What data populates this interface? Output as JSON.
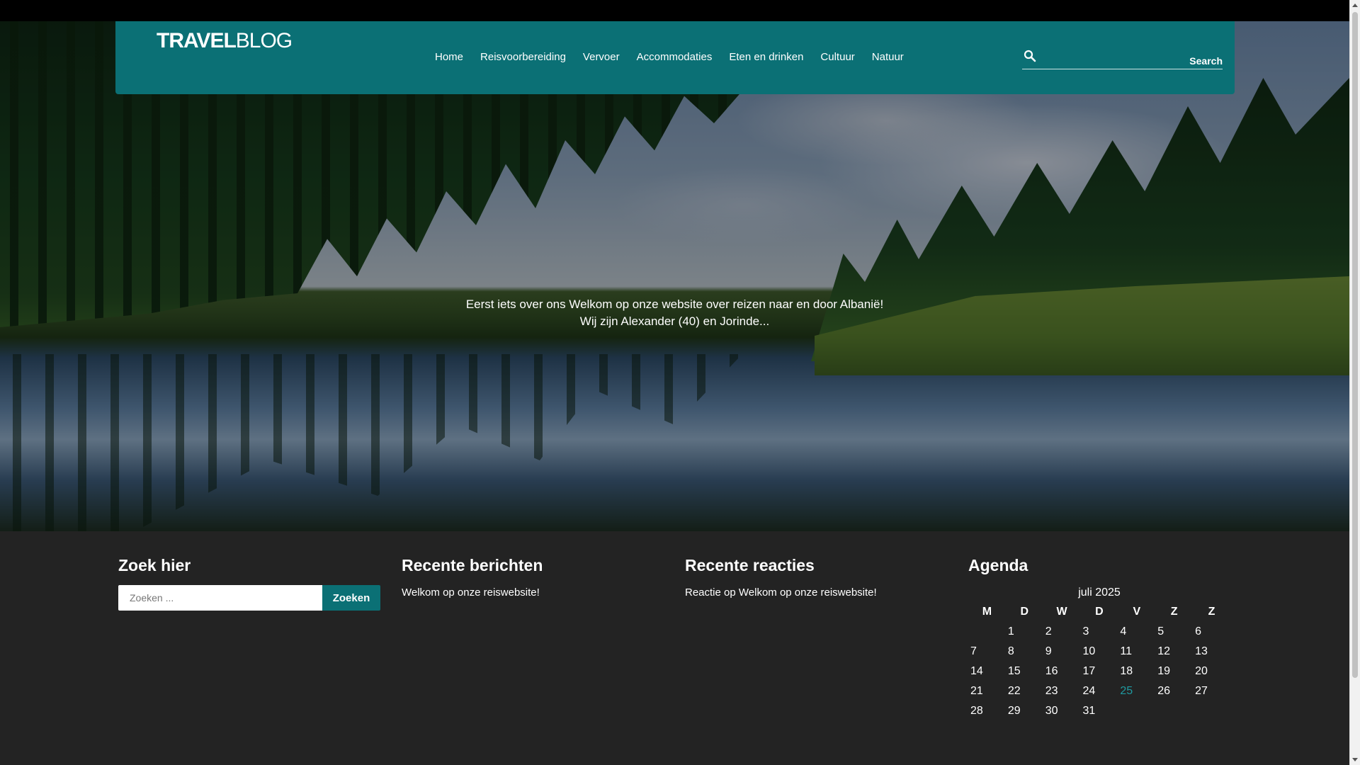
{
  "logo": {
    "bold": "TRAVEL",
    "light": "BLOG"
  },
  "nav": [
    {
      "label": "Home"
    },
    {
      "label": "Reisvoorbereiding"
    },
    {
      "label": "Vervoer"
    },
    {
      "label": "Accommodaties"
    },
    {
      "label": "Eten en drinken"
    },
    {
      "label": "Cultuur"
    },
    {
      "label": "Natuur"
    }
  ],
  "header_search": {
    "label": "Search",
    "icon": "search-icon"
  },
  "hero": {
    "line1": "Eerst iets over ons Welkom op onze website over reizen naar en door Albanië!",
    "line2": "Wij zijn Alexander (40) en Jorinde..."
  },
  "widgets": {
    "search": {
      "title": "Zoek hier",
      "placeholder": "Zoeken ...",
      "button": "Zoeken"
    },
    "recent_posts": {
      "title": "Recente berichten",
      "items": [
        "Welkom op onze reiswebsite!"
      ]
    },
    "recent_comments": {
      "title": "Recente reacties",
      "items": [
        "Reactie op Welkom op onze reiswebsite!"
      ]
    },
    "calendar": {
      "title": "Agenda",
      "caption": "juli 2025",
      "weekdays": [
        "M",
        "D",
        "W",
        "D",
        "V",
        "Z",
        "Z"
      ],
      "weeks": [
        [
          "",
          "1",
          "2",
          "3",
          "4",
          "5",
          "6"
        ],
        [
          "7",
          "8",
          "9",
          "10",
          "11",
          "12",
          "13"
        ],
        [
          "14",
          "15",
          "16",
          "17",
          "18",
          "19",
          "20"
        ],
        [
          "21",
          "22",
          "23",
          "24",
          "25",
          "26",
          "27"
        ],
        [
          "28",
          "29",
          "30",
          "31",
          "",
          "",
          ""
        ]
      ],
      "today": "25",
      "today_color": "#1f9aa0"
    }
  },
  "colors": {
    "accent": "#0b7075",
    "footer_bg": "#232323"
  }
}
